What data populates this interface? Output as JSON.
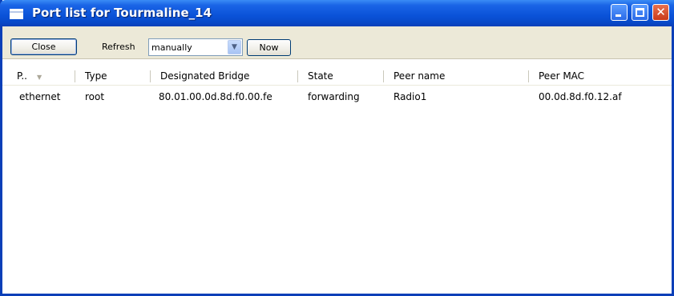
{
  "window": {
    "title": "Port list for Tourmaline_14",
    "controls": {
      "minimize_icon": "minimize-icon",
      "maximize_icon": "maximize-icon",
      "close_glyph": "✕"
    }
  },
  "toolbar": {
    "close_label": "Close",
    "refresh_label": "Refresh",
    "refresh_select_value": "manually",
    "select_arrow": "▼",
    "now_label": "Now"
  },
  "table": {
    "columns": [
      "P..",
      "Type",
      "Designated Bridge",
      "State",
      "Peer name",
      "Peer MAC"
    ],
    "sort_arrow": "▼",
    "rows": [
      [
        "ethernet",
        "root",
        "80.01.00.0d.8d.f0.00.fe",
        "forwarding",
        "Radio1",
        "00.0d.8d.f0.12.af"
      ]
    ]
  },
  "colors": {
    "titlebar": "#0a52d8",
    "toolbar_bg": "#ece9d8",
    "frame": "#0a3fb8"
  }
}
